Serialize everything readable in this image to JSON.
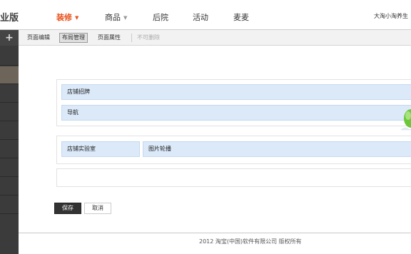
{
  "header": {
    "brand": "业版",
    "nav": [
      {
        "label": "装修",
        "active": true,
        "has_caret": true
      },
      {
        "label": "商品",
        "active": false,
        "has_caret": true
      },
      {
        "label": "后院",
        "active": false,
        "has_caret": false
      },
      {
        "label": "活动",
        "active": false,
        "has_caret": false
      },
      {
        "label": "麦麦",
        "active": false,
        "has_caret": false
      }
    ],
    "shop_name": "大淘小淘养生",
    "caret_icon": "▼"
  },
  "sidebar": {
    "add_icon": "+",
    "items": 9,
    "active_index": 1
  },
  "toolbar": {
    "items": [
      {
        "label": "页面编辑",
        "state": "normal"
      },
      {
        "label": "布局管理",
        "state": "active"
      },
      {
        "label": "页面属性",
        "state": "normal"
      },
      {
        "label": "不可删除",
        "state": "disabled"
      }
    ]
  },
  "layout": {
    "section1": {
      "modules": [
        "店铺招牌",
        "导航"
      ]
    },
    "section2": {
      "modules": [
        "店铺实验室",
        "图片轮播"
      ]
    }
  },
  "actions": {
    "save_label": "保存",
    "cancel_label": "取消"
  },
  "footer": {
    "copyright": "2012 淘宝(中国)软件有限公司 版权所有"
  },
  "colors": {
    "accent": "#e8531e",
    "module_bg": "#dbe9f9",
    "sidebar_bg": "#3b3b3b",
    "sidebar_active": "#6e655a"
  }
}
